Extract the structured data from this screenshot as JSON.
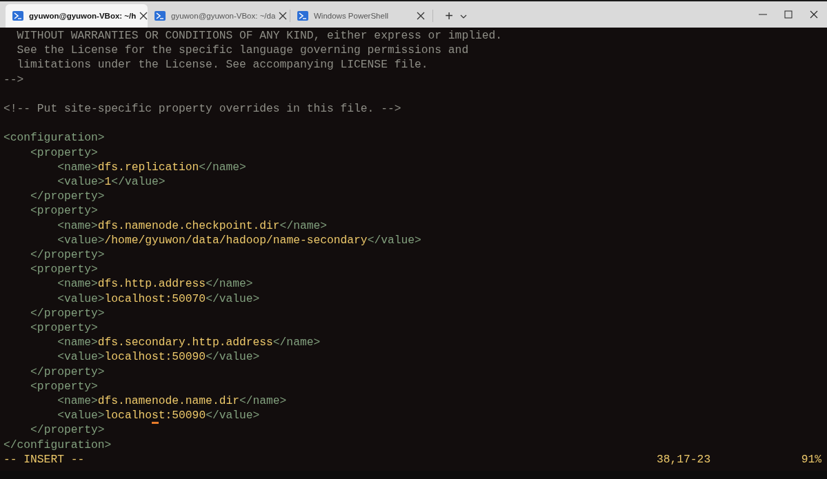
{
  "tabs": [
    {
      "label": "gyuwon@gyuwon-VBox: ~/h",
      "selected": true
    },
    {
      "label": "gyuwon@gyuwon-VBox: ~/da",
      "selected": false
    },
    {
      "label": "Windows PowerShell",
      "selected": false
    }
  ],
  "new_tab": "+",
  "lines": [
    [
      {
        "kind": "comment",
        "text": "  WITHOUT WARRANTIES OR CONDITIONS OF ANY KIND, either express or implied."
      }
    ],
    [
      {
        "kind": "comment",
        "text": "  See the License for the specific language governing permissions and"
      }
    ],
    [
      {
        "kind": "comment",
        "text": "  limitations under the License. See accompanying LICENSE file."
      }
    ],
    [
      {
        "kind": "comment",
        "text": "-->"
      }
    ],
    [
      {
        "kind": "comment",
        "text": "<!-- Put site-specific property overrides in this file. -->",
        "blank_before": true
      }
    ],
    [
      {
        "kind": "tag",
        "text": "<configuration>",
        "blank_before": true
      }
    ],
    [
      {
        "kind": "tag",
        "text": "    <property>"
      }
    ],
    [
      {
        "kind": "tag",
        "text": "        <name>"
      },
      {
        "kind": "value",
        "text": "dfs.replication"
      },
      {
        "kind": "tag",
        "text": "</name>"
      }
    ],
    [
      {
        "kind": "tag",
        "text": "        <value>"
      },
      {
        "kind": "value",
        "text": "1"
      },
      {
        "kind": "tag",
        "text": "</value>"
      }
    ],
    [
      {
        "kind": "tag",
        "text": "    </property>"
      }
    ],
    [
      {
        "kind": "tag",
        "text": "    <property>"
      }
    ],
    [
      {
        "kind": "tag",
        "text": "        <name>"
      },
      {
        "kind": "value",
        "text": "dfs.namenode.checkpoint.dir"
      },
      {
        "kind": "tag",
        "text": "</name>"
      }
    ],
    [
      {
        "kind": "tag",
        "text": "        <value>"
      },
      {
        "kind": "value",
        "text": "/home/gyuwon/data/hadoop/name-secondary"
      },
      {
        "kind": "tag",
        "text": "</value>"
      }
    ],
    [
      {
        "kind": "tag",
        "text": "    </property>"
      }
    ],
    [
      {
        "kind": "tag",
        "text": "    <property>"
      }
    ],
    [
      {
        "kind": "tag",
        "text": "        <name>"
      },
      {
        "kind": "value",
        "text": "dfs.http.address"
      },
      {
        "kind": "tag",
        "text": "</name>"
      }
    ],
    [
      {
        "kind": "tag",
        "text": "        <value>"
      },
      {
        "kind": "value",
        "text": "localhost:50070"
      },
      {
        "kind": "tag",
        "text": "</value>"
      }
    ],
    [
      {
        "kind": "tag",
        "text": "    </property>"
      }
    ],
    [
      {
        "kind": "tag",
        "text": "    <property>"
      }
    ],
    [
      {
        "kind": "tag",
        "text": "        <name>"
      },
      {
        "kind": "value",
        "text": "dfs.secondary.http.address"
      },
      {
        "kind": "tag",
        "text": "</name>"
      }
    ],
    [
      {
        "kind": "tag",
        "text": "        <value>"
      },
      {
        "kind": "value",
        "text": "localhost:50090"
      },
      {
        "kind": "tag",
        "text": "</value>"
      }
    ],
    [
      {
        "kind": "tag",
        "text": "    </property>"
      }
    ],
    [
      {
        "kind": "tag",
        "text": "    <property>"
      }
    ],
    [
      {
        "kind": "tag",
        "text": "        <name>"
      },
      {
        "kind": "value",
        "text": "dfs.namenode.name.dir"
      },
      {
        "kind": "tag",
        "text": "</name>"
      }
    ],
    [
      {
        "kind": "tag",
        "text": "        <value>"
      },
      {
        "kind": "value",
        "text": "localho"
      },
      {
        "kind": "value",
        "text": "s",
        "cursor": true
      },
      {
        "kind": "value",
        "text": "t:50090"
      },
      {
        "kind": "tag",
        "text": "</value>"
      }
    ],
    [
      {
        "kind": "tag",
        "text": "    </property>"
      }
    ],
    [
      {
        "kind": "tag",
        "text": "</configuration>"
      }
    ]
  ],
  "status": {
    "mode": "-- INSERT --",
    "position": "38,17-23",
    "scroll": "91%"
  }
}
